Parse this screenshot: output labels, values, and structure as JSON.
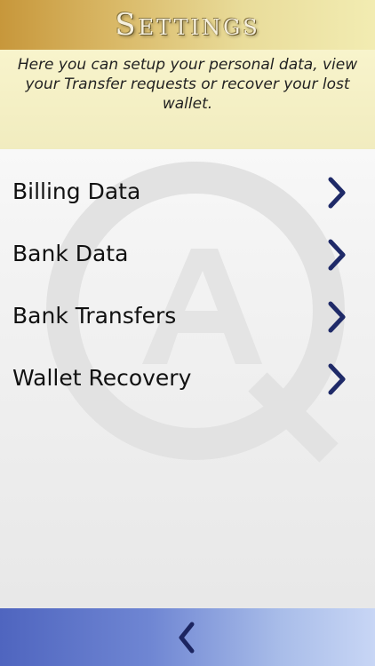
{
  "header": {
    "title": "Settings"
  },
  "intro": {
    "text": "Here you can setup your personal data, view your Transfer requests or recover your lost wallet."
  },
  "menu": {
    "items": [
      {
        "label": "Billing Data",
        "icon": "chevron-right-icon"
      },
      {
        "label": "Bank Data",
        "icon": "chevron-right-icon"
      },
      {
        "label": "Bank Transfers",
        "icon": "chevron-right-icon"
      },
      {
        "label": "Wallet Recovery",
        "icon": "chevron-right-icon"
      }
    ]
  },
  "footer": {
    "back_icon": "chevron-left-icon"
  },
  "colors": {
    "header_gold": "#c7973b",
    "intro_bg": "#f8f4cc",
    "accent_navy": "#23327a",
    "footer_blue": "#4f65bf"
  }
}
